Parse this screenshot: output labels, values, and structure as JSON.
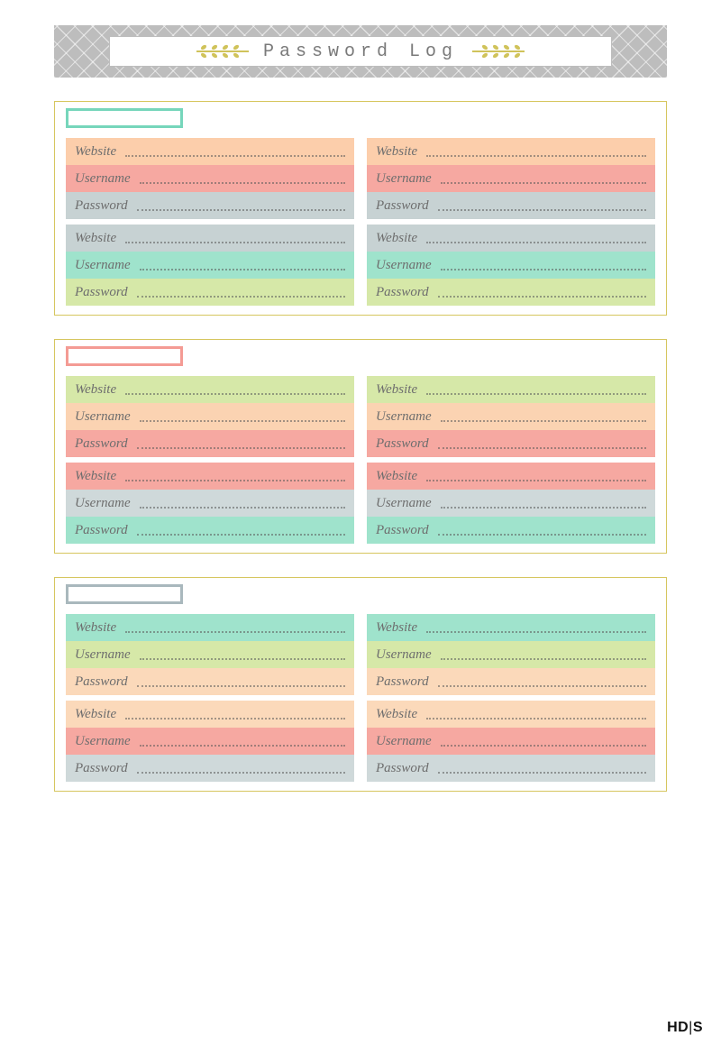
{
  "header": {
    "title": "Password Log"
  },
  "labels": {
    "website": "Website",
    "username": "Username",
    "password": "Password"
  },
  "sections": [
    {
      "tab_color": "mint",
      "cards": [
        {
          "rows": [
            "peach",
            "coral",
            "slate"
          ]
        },
        {
          "rows": [
            "peach",
            "coral",
            "slate"
          ]
        },
        {
          "rows": [
            "slate",
            "mint",
            "lime"
          ]
        },
        {
          "rows": [
            "slate",
            "mint",
            "lime"
          ]
        }
      ]
    },
    {
      "tab_color": "coral",
      "cards": [
        {
          "rows": [
            "lime",
            "peach2",
            "coral"
          ]
        },
        {
          "rows": [
            "lime",
            "peach2",
            "coral"
          ]
        },
        {
          "rows": [
            "coral",
            "slate2",
            "mint"
          ]
        },
        {
          "rows": [
            "coral",
            "slate2",
            "mint"
          ]
        }
      ]
    },
    {
      "tab_color": "slate",
      "cards": [
        {
          "rows": [
            "mint",
            "lime",
            "peachL"
          ]
        },
        {
          "rows": [
            "mint",
            "lime",
            "peachL"
          ]
        },
        {
          "rows": [
            "peachL",
            "coral",
            "slate2"
          ]
        },
        {
          "rows": [
            "peachL",
            "coral",
            "slate2"
          ]
        }
      ]
    }
  ],
  "watermark": {
    "left": "HD",
    "right": "S"
  }
}
